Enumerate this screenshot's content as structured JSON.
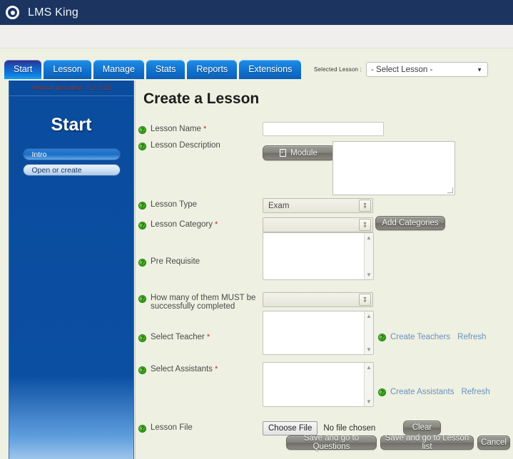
{
  "header": {
    "brand": "LMS King",
    "brand_icon": "record-circle-icon",
    "bg_color": "#1b3560"
  },
  "tabs": [
    {
      "label": "Start",
      "active": true
    },
    {
      "label": "Lesson",
      "active": false
    },
    {
      "label": "Manage",
      "active": false
    },
    {
      "label": "Stats",
      "active": false
    },
    {
      "label": "Reports",
      "active": false
    },
    {
      "label": "Extensions",
      "active": false
    }
  ],
  "selected_lesson": {
    "label": "Selected Lesson :",
    "value": "- Select Lesson -",
    "caret": "▼"
  },
  "sidebar": {
    "version": "Version Installed : 8.2.3.18",
    "title": "Start",
    "items": [
      {
        "label": "Intro",
        "selected": true
      },
      {
        "label": "Open or create",
        "selected": false
      }
    ]
  },
  "main": {
    "page_title": "Create a Lesson",
    "fields": {
      "lesson_name": {
        "label": "Lesson Name",
        "required": "*",
        "value": ""
      },
      "lesson_description": {
        "label": "Lesson Description",
        "value": "",
        "module_button": "Module"
      },
      "lesson_type": {
        "label": "Lesson Type",
        "value": "Exam"
      },
      "lesson_category": {
        "label": "Lesson Category",
        "required": "*",
        "value": "",
        "add_button": "Add Categories"
      },
      "pre_requisite": {
        "label": "Pre Requisite",
        "value": ""
      },
      "must_complete": {
        "label": "How many of them MUST be successfully completed",
        "value": ""
      },
      "select_teacher": {
        "label": "Select Teacher",
        "required": "*",
        "value": "",
        "create_link": "Create Teachers",
        "refresh_link": "Refresh"
      },
      "select_assistants": {
        "label": "Select Assistants",
        "required": "*",
        "value": "",
        "create_link": "Create Assistants",
        "refresh_link": "Refresh"
      },
      "lesson_file": {
        "label": "Lesson File",
        "choose_button": "Choose File",
        "file_status": "No file chosen",
        "clear_button": "Clear"
      }
    },
    "actions": {
      "save_questions": "Save and go to Questions",
      "save_lesson_list": "Save and go to Lesson list",
      "cancel": "Cancel"
    }
  },
  "colors": {
    "content_bg": "#eef0e2",
    "sidebar_blue": "#0a4c9e",
    "tab_blue": "#1477d4",
    "link_blue": "#6a91c0",
    "required_red": "#cc2222",
    "version_red": "#8b3a3a"
  }
}
